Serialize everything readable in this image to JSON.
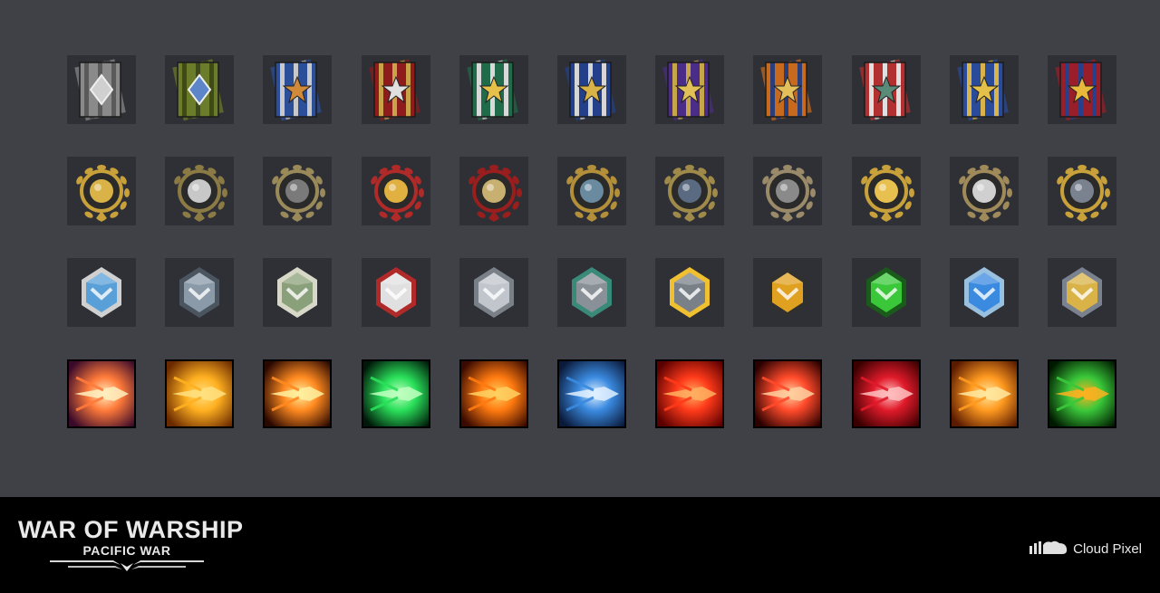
{
  "rows": [
    {
      "kind": "ribbon",
      "items": [
        {
          "icon": "silver-rank-ribbon-icon",
          "stripe": "#8a8a8a",
          "stripe2": "#5a5a5a",
          "emblem": "#d0d0d0"
        },
        {
          "icon": "olive-rank-ribbon-icon",
          "stripe": "#6b7d2a",
          "stripe2": "#3f4a18",
          "emblem": "#5c86c9"
        },
        {
          "icon": "blue-compass-ribbon-icon",
          "stripe": "#2c4f9a",
          "stripe2": "#c9c9c9",
          "emblem": "#d08a3a"
        },
        {
          "icon": "red-laurel-ribbon-icon",
          "stripe": "#8e1c1c",
          "stripe2": "#c9a24a",
          "emblem": "#e0e0e0"
        },
        {
          "icon": "green-star-ribbon-icon",
          "stripe": "#1f6b4a",
          "stripe2": "#d9d9d9",
          "emblem": "#e6c14a"
        },
        {
          "icon": "navy-double-star-ribbon-icon",
          "stripe": "#24408a",
          "stripe2": "#d6d6d6",
          "emblem": "#d9b347"
        },
        {
          "icon": "purple-triple-star-ribbon-icon",
          "stripe": "#4b2c86",
          "stripe2": "#c7a64a",
          "emblem": "#e2c057"
        },
        {
          "icon": "orange-star-cross-ribbon-icon",
          "stripe": "#c76a1e",
          "stripe2": "#2a3f7a",
          "emblem": "#e3c05a"
        },
        {
          "icon": "red-white-star-ribbon-icon",
          "stripe": "#b23030",
          "stripe2": "#e0e0e0",
          "emblem": "#5a8a78"
        },
        {
          "icon": "blue-gold-anchor-ribbon-icon",
          "stripe": "#2a4b9a",
          "stripe2": "#d8b44a",
          "emblem": "#e6c14a"
        },
        {
          "icon": "red-gold-star-ribbon-icon",
          "stripe": "#9a1e2a",
          "stripe2": "#2a3f8a",
          "emblem": "#e8b93a"
        }
      ]
    },
    {
      "kind": "medal",
      "items": [
        {
          "icon": "gold-aircraft-medal-icon",
          "ring": "#c9a13a",
          "core": "#d9b347"
        },
        {
          "icon": "silver-sphere-medal-icon",
          "ring": "#8c7a44",
          "core": "#c8c8c8"
        },
        {
          "icon": "gear-wrench-medal-icon",
          "ring": "#9a8a5a",
          "core": "#7a7a7a"
        },
        {
          "icon": "gold-gear-star-medal-icon",
          "ring": "#b02a2a",
          "core": "#e0b040"
        },
        {
          "icon": "skull-cross-medal-icon",
          "ring": "#9a1e1e",
          "core": "#c8b070"
        },
        {
          "icon": "aircraft-missile-medal-icon",
          "ring": "#b38f3a",
          "core": "#6a8aa0"
        },
        {
          "icon": "warship-star-medal-icon",
          "ring": "#a08a4a",
          "core": "#5a6a80"
        },
        {
          "icon": "bomber-aircraft-medal-icon",
          "ring": "#9a8a6a",
          "core": "#8a8a8a"
        },
        {
          "icon": "gold-orb-medal-icon",
          "ring": "#c9a13a",
          "core": "#e8c050"
        },
        {
          "icon": "silver-orb-star-medal-icon",
          "ring": "#a08a5a",
          "core": "#d0d0d0"
        },
        {
          "icon": "battleship-laurel-medal-icon",
          "ring": "#c9a13a",
          "core": "#7a8290"
        }
      ]
    },
    {
      "kind": "item",
      "items": [
        {
          "icon": "winged-chevron-badge-icon",
          "main": "#5aa0d8",
          "accent": "#d0d0d0"
        },
        {
          "icon": "steel-armor-plate-icon",
          "main": "#8a9aa8",
          "accent": "#4a5560"
        },
        {
          "icon": "cash-stack-icon",
          "main": "#8aa07a",
          "accent": "#d8d8c8"
        },
        {
          "icon": "star-chevron-badge-icon",
          "main": "#e0e0e0",
          "accent": "#b02a2a"
        },
        {
          "icon": "radar-dish-icon",
          "main": "#c0c6cc",
          "accent": "#7a8088"
        },
        {
          "icon": "chevron-rank-shield-icon",
          "main": "#8a9098",
          "accent": "#3a8a7a"
        },
        {
          "icon": "energy-warhead-icon",
          "main": "#7a8088",
          "accent": "#f0c030"
        },
        {
          "icon": "radioactive-canister-icon",
          "main": "#e0a020",
          "accent": "#303030"
        },
        {
          "icon": "green-repair-token-icon",
          "main": "#3ac83a",
          "accent": "#1a5a1a"
        },
        {
          "icon": "blue-energy-cell-icon",
          "main": "#3a8ae0",
          "accent": "#9ac0e0"
        },
        {
          "icon": "winged-ring-emblem-icon",
          "main": "#d9b347",
          "accent": "#7a8290"
        }
      ]
    },
    {
      "kind": "skill",
      "items": [
        {
          "icon": "piercing-shell-skill-icon",
          "bg": "#3a0a2a",
          "glow": "#ff7a3a",
          "core": "#fff0c0"
        },
        {
          "icon": "rapid-fire-bullet-skill-icon",
          "bg": "#6a2a00",
          "glow": "#ffb020",
          "core": "#ffe080"
        },
        {
          "icon": "flame-cannon-skill-icon",
          "bg": "#2a0800",
          "glow": "#ff8a20",
          "core": "#fff0a0"
        },
        {
          "icon": "green-cycle-skill-icon",
          "bg": "#001a0a",
          "glow": "#2ae05a",
          "core": "#c0ffc0"
        },
        {
          "icon": "fire-shell-skill-icon",
          "bg": "#3a0a00",
          "glow": "#ff7a10",
          "core": "#ffd060"
        },
        {
          "icon": "torpedo-dash-skill-icon",
          "bg": "#0a1a3a",
          "glow": "#3a8ae0",
          "core": "#e0f0ff"
        },
        {
          "icon": "red-arrow-power-skill-icon",
          "bg": "#5a0000",
          "glow": "#ff3a1a",
          "core": "#ffb060"
        },
        {
          "icon": "meteor-strike-skill-icon",
          "bg": "#2a0000",
          "glow": "#ff4a2a",
          "core": "#ffd0a0"
        },
        {
          "icon": "crimson-barrage-skill-icon",
          "bg": "#3a0000",
          "glow": "#e01a2a",
          "core": "#ffc0c0"
        },
        {
          "icon": "missile-salvo-skill-icon",
          "bg": "#5a1a00",
          "glow": "#ff9a20",
          "core": "#ffe8a0"
        },
        {
          "icon": "radar-warning-skill-icon",
          "bg": "#001a00",
          "glow": "#3ac83a",
          "core": "#ffb020"
        }
      ]
    }
  ],
  "footer": {
    "logo_title": "WAR OF WARSHIP",
    "logo_subtitle": "PACIFIC WAR",
    "brand_name": "Cloud Pixel",
    "brand_icon": "cloud-pixel-logo-icon"
  }
}
